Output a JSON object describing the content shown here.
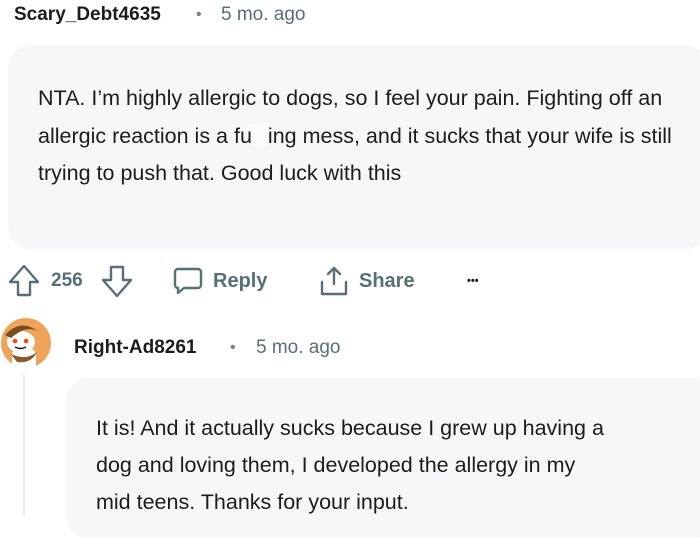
{
  "comment1": {
    "author": "Scary_Debt4635",
    "separator": "•",
    "time": "5 mo. ago",
    "body": {
      "part1": "NTA. I’m highly allergic to dogs, so I feel your pain. Fighting off an allergic reaction is a fu",
      "part2": "ing mess, and it sucks that your wife is still trying to push that. Good luck with this"
    },
    "actions": {
      "vote_count": "256",
      "reply_label": "Reply",
      "share_label": "Share",
      "more_label": "•••"
    }
  },
  "comment2": {
    "author": "Right-Ad8261",
    "separator": "•",
    "time": "5 mo. ago",
    "body_lines": [
      "It is! And it actually sucks because I grew up having a",
      "dog and loving them, I developed the allergy in my",
      "mid teens. Thanks for your input."
    ],
    "avatar_color": "#f0a35a"
  },
  "colors": {
    "bubble_bg": "#f6f7f8",
    "meta_text": "#576f76",
    "body_text": "#1c1c1c"
  }
}
